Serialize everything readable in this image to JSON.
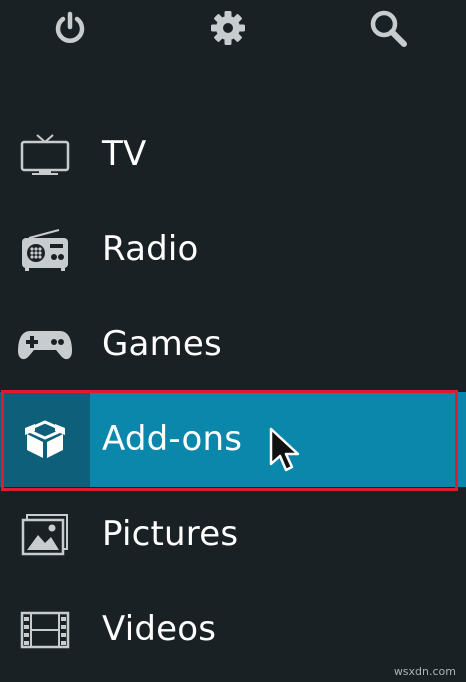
{
  "top_bar": {
    "icons": [
      "power-icon",
      "settings-gear-icon",
      "search-icon"
    ]
  },
  "menu": {
    "items": [
      {
        "label": "TV",
        "icon": "tv-icon"
      },
      {
        "label": "Radio",
        "icon": "radio-icon"
      },
      {
        "label": "Games",
        "icon": "gamepad-icon"
      },
      {
        "label": "Add-ons",
        "icon": "addon-box-icon",
        "selected": true
      },
      {
        "label": "Pictures",
        "icon": "pictures-icon"
      },
      {
        "label": "Videos",
        "icon": "film-icon"
      }
    ]
  },
  "watermark": "wsxdn.com",
  "colors": {
    "background": "#1a2124",
    "selected_bg": "#0a87aa",
    "selected_icon_bg": "#0d5f7a",
    "highlight_border": "#e21b2c",
    "icon": "#c7ccce"
  }
}
